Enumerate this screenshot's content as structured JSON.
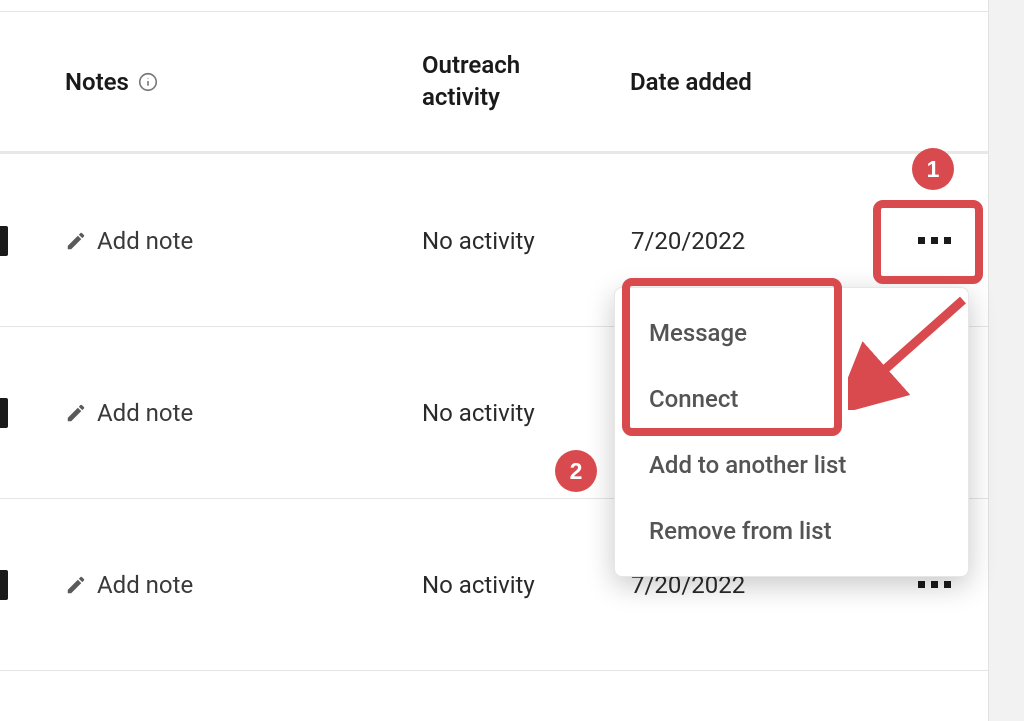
{
  "columns": {
    "notes": "Notes",
    "activity": "Outreach activity",
    "date": "Date added"
  },
  "rows": [
    {
      "note_action": "Add note",
      "activity": "No activity",
      "date": "7/20/2022"
    },
    {
      "note_action": "Add note",
      "activity": "No activity",
      "date": ""
    },
    {
      "note_action": "Add note",
      "activity": "No activity",
      "date": "7/20/2022"
    }
  ],
  "dropdown": {
    "items": [
      "Message",
      "Connect",
      "Add to another list",
      "Remove from list"
    ]
  },
  "annotations": {
    "badge1": "1",
    "badge2": "2"
  }
}
